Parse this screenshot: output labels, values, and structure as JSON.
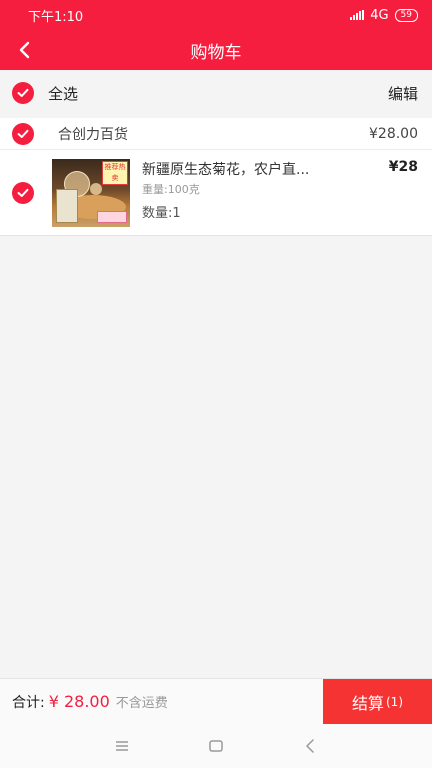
{
  "status_bar": {
    "time": "下午1:10",
    "network": "4G",
    "battery": "59"
  },
  "header": {
    "title": "购物车"
  },
  "toolbar": {
    "select_all_label": "全选",
    "edit_label": "编辑"
  },
  "store": {
    "name": "合创力百货",
    "total": "¥28.00",
    "items": [
      {
        "name": "新疆原生态菊花，农户直...",
        "spec": "重量:100克",
        "qty": "数量:1",
        "price": "¥28",
        "thumb_badge": "推荐热卖"
      }
    ]
  },
  "footer": {
    "total_label": "合计:",
    "total_value": "¥ 28.00",
    "shipping_note": "不含运费",
    "checkout_label": "结算",
    "checkout_count": "(1)"
  },
  "colors": {
    "accent": "#f51e3f",
    "checkout": "#f53333"
  },
  "icons": [
    "back-arrow-icon",
    "check-circle-icon",
    "menu-icon",
    "home-icon",
    "nav-back-icon"
  ]
}
